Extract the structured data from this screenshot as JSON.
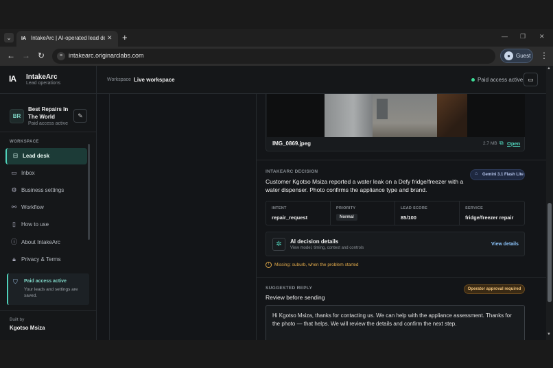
{
  "browser": {
    "tab_menu": "⌄",
    "tab_favicon": "IA",
    "tab_title": "IntakeArc | AI-operated lead de",
    "tab_close": "✕",
    "new_tab": "+",
    "url": "intakearc.originarclabs.com",
    "guest_label": "Guest",
    "window_controls": [
      "—",
      "❐",
      "✕"
    ]
  },
  "brand": {
    "logo": "IA",
    "name": "IntakeArc",
    "subtitle": "Lead operations"
  },
  "business": {
    "initials": "BR",
    "name": "Best Repairs In The World",
    "status": "Paid access active"
  },
  "sidebar": {
    "section": "WORKSPACE",
    "items": [
      {
        "label": "Lead desk",
        "icon": "inbox-tray-icon",
        "active": true
      },
      {
        "label": "Inbox",
        "icon": "inbox-icon"
      },
      {
        "label": "Business settings",
        "icon": "gear-icon"
      },
      {
        "label": "Workflow",
        "icon": "workflow-icon"
      },
      {
        "label": "How to use",
        "icon": "book-icon"
      },
      {
        "label": "About IntakeArc",
        "icon": "info-icon"
      },
      {
        "label": "Privacy & Terms",
        "icon": "lock-icon"
      }
    ],
    "paid_title": "Paid access active",
    "paid_text": "Your leads and settings are saved.",
    "built_label": "Built by",
    "built_name": "Kgotso Msiza"
  },
  "topbar": {
    "workspace_label": "Workspace",
    "workspace_name": "Live workspace",
    "status": "Paid access active"
  },
  "attachment": {
    "filename": "IMG_0869.jpeg",
    "size": "2.7 MB",
    "open_label": "Open"
  },
  "decision": {
    "label": "INTAKEARC DECISION",
    "summary": "Customer Kgotso Msiza reported a water leak on a Defy fridge/freezer with a water dispenser. Photo confirms the appliance type and brand.",
    "model": "Gemini 3.1 Flash Lite",
    "stats": [
      {
        "label": "INTENT",
        "value": "repair_request"
      },
      {
        "label": "PRIORITY",
        "value": "Normal"
      },
      {
        "label": "LEAD SCORE",
        "value": "85/100"
      },
      {
        "label": "SERVICE",
        "value": "fridge/freezer repair"
      }
    ],
    "details_title": "AI decision details",
    "details_sub": "View model, timing, context and controls",
    "details_link": "View details",
    "missing": "Missing: suburb, when the problem started"
  },
  "reply": {
    "label": "SUGGESTED REPLY",
    "title": "Review before sending",
    "approval": "Operator approval required",
    "text": "Hi Kgotso Msiza, thanks for contacting us. We can help with the appliance assessment. Thanks for the photo — that helps. We will review the details and confirm the next step."
  },
  "colors": {
    "accent": "#4fd1b9",
    "status_green": "#3ddc97",
    "warning": "#e0a94a",
    "link_blue": "#8ec7ff"
  }
}
